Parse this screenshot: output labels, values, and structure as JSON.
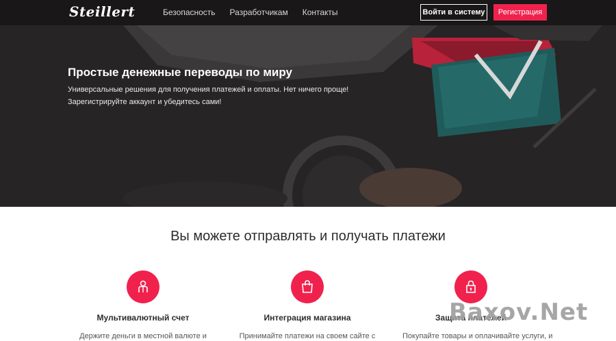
{
  "header": {
    "logo": "Steillert",
    "nav": [
      "Безопасность",
      "Разработчикам",
      "Контакты"
    ],
    "login_label": "Войти в систему",
    "register_label": "Регистрация"
  },
  "hero": {
    "title": "Простые денежные переводы по миру",
    "subtitle_line1": "Универсальные решения для получения платежей и оплаты. Нет ничего проще!",
    "subtitle_line2": "Зарегистрируйте аккаунт и убедитесь сами!"
  },
  "features": {
    "title": "Вы можете отправлять и получать платежи",
    "items": [
      {
        "icon": "user-icon",
        "title": "Мультивалютный счет",
        "desc": "Держите деньги в местной валюте и"
      },
      {
        "icon": "shopping-bag-icon",
        "title": "Интеграция магазина",
        "desc": "Принимайте платежи на своем сайте с"
      },
      {
        "icon": "lock-icon",
        "title": "Защита платежей",
        "desc": "Покупайте товары и оплачивайте услуги, и"
      }
    ]
  },
  "watermark": "Baxov.Net",
  "colors": {
    "accent": "#f0224d",
    "hero_bg": "#262425",
    "topbar_bg": "#191718"
  }
}
